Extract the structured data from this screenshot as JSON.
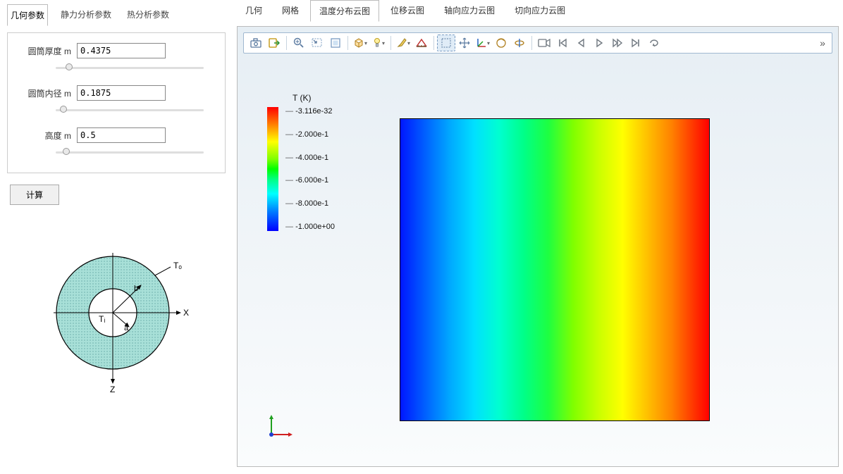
{
  "left_tabs": {
    "tab1": "几何参数",
    "tab2": "静力分析参数",
    "tab3": "热分析参数"
  },
  "params": {
    "thickness_label": "圆筒厚度 m",
    "thickness_value": "0.4375",
    "inner_label": "圆筒内径 m",
    "inner_value": "0.1875",
    "height_label": "高度 m",
    "height_value": "0.5"
  },
  "calc_btn": "计算",
  "diagram": {
    "To": "Tₒ",
    "Ti": "Tᵢ",
    "a": "a",
    "b": "b",
    "X": "X",
    "Z": "Z"
  },
  "right_tabs": {
    "t1": "几何",
    "t2": "网格",
    "t3": "温度分布云图",
    "t4": "位移云图",
    "t5": "轴向应力云图",
    "t6": "切向应力云图"
  },
  "legend": {
    "title": "T (K)",
    "v0": "-3.116e-32",
    "v1": "-2.000e-1",
    "v2": "-4.000e-1",
    "v3": "-6.000e-1",
    "v4": "-8.000e-1",
    "v5": "-1.000e+00"
  },
  "triad": {
    "x_color": "#d02020",
    "y_color": "#20a020",
    "z_color": "#2040d0"
  },
  "icons": {
    "camera": "camera",
    "export": "export",
    "zoom": "zoom",
    "zoombox": "zoom-box",
    "fit": "fit",
    "cube": "cube",
    "light": "light",
    "brush": "brush",
    "ruler": "ruler",
    "select": "select-box",
    "move": "pan",
    "axes": "axes",
    "orbit": "orbit",
    "orbit2": "orbit-constrained",
    "vcam": "video-camera",
    "first": "first-frame",
    "prev": "prev-frame",
    "play": "play",
    "playfwd": "play-fwd",
    "last": "last-frame",
    "loop": "loop",
    "expand": "»"
  }
}
